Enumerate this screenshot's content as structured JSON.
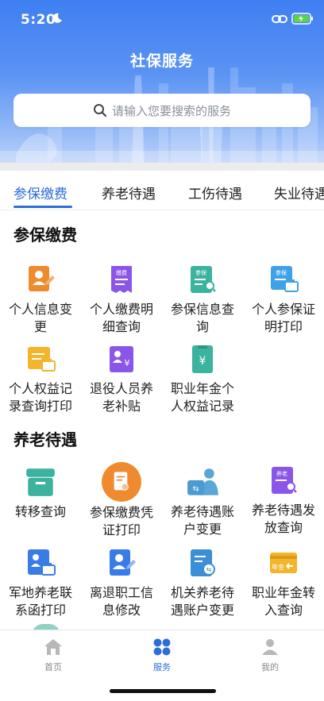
{
  "status_bar": {
    "time": "5:20"
  },
  "header": {
    "title": "社保服务",
    "search_placeholder": "请输入您要搜索的服务"
  },
  "tabs": [
    {
      "label": "参保缴费",
      "active": true
    },
    {
      "label": "养老待遇",
      "active": false
    },
    {
      "label": "工伤待遇",
      "active": false
    },
    {
      "label": "失业待遇",
      "active": false
    }
  ],
  "sections": [
    {
      "title": "参保缴费",
      "items": [
        {
          "label": "个人信息变更",
          "icon": "person-edit-icon"
        },
        {
          "label": "个人缴费明细查询",
          "icon": "payment-receipt-icon"
        },
        {
          "label": "参保信息查询",
          "icon": "insurance-search-icon"
        },
        {
          "label": "个人参保证明打印",
          "icon": "certificate-print-icon"
        },
        {
          "label": "个人权益记录查询打印",
          "icon": "rights-print-icon"
        },
        {
          "label": "退役人员养老补贴",
          "icon": "veteran-subsidy-icon"
        },
        {
          "label": "职业年金个人权益记录",
          "icon": "annuity-yen-icon"
        }
      ]
    },
    {
      "title": "养老待遇",
      "items": [
        {
          "label": "转移查询",
          "icon": "transfer-box-icon"
        },
        {
          "label": "参保缴费凭证打印",
          "icon": "voucher-print-icon"
        },
        {
          "label": "养老待遇账户变更",
          "icon": "account-change-icon"
        },
        {
          "label": "养老待遇发放查询",
          "icon": "pension-search-icon"
        },
        {
          "label": "军地养老联系函打印",
          "icon": "letter-print-icon"
        },
        {
          "label": "离退职工信息修改",
          "icon": "retiree-edit-icon"
        },
        {
          "label": "机关养老待遇账户变更",
          "icon": "agency-account-icon"
        },
        {
          "label": "职业年金转入查询",
          "icon": "annuity-transfer-icon"
        }
      ]
    }
  ],
  "icon_badges": {
    "payment": "缴费",
    "insurance": "参保",
    "pension": "养老",
    "annuity": "年金"
  },
  "bottom_nav": [
    {
      "label": "首页",
      "icon": "home-icon",
      "active": false
    },
    {
      "label": "服务",
      "icon": "services-grid-icon",
      "active": true
    },
    {
      "label": "我的",
      "icon": "profile-icon",
      "active": false
    }
  ],
  "colors": {
    "primary": "#2c6ed9",
    "orange": "#f08a2e",
    "purple": "#8b56e8",
    "teal": "#3bb39e",
    "sky": "#3fa2e8",
    "yellow": "#f2b52c",
    "blue": "#3a7ce6"
  }
}
